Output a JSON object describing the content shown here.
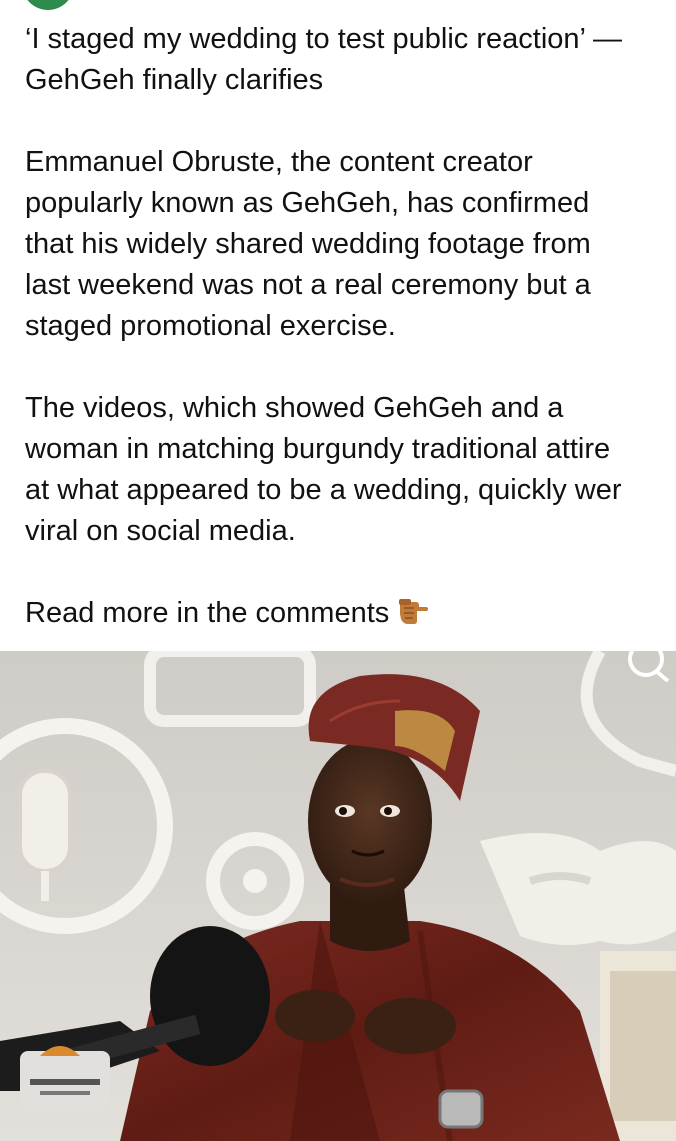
{
  "post": {
    "headline_line1": "‘I staged my wedding to test public reaction’ —",
    "headline_line2": "GehGeh finally clarifies",
    "para1": [
      "Emmanuel Obruste, the content creator",
      "popularly known as GehGeh, has confirmed",
      "that his widely shared wedding footage from",
      "last weekend was not a real ceremony but a",
      "staged promotional exercise."
    ],
    "para2": [
      "The videos, which showed GehGeh and a",
      "woman in matching burgundy traditional attire",
      "at what appeared to be a wedding, quickly wer",
      "viral on social media."
    ],
    "read_more": "Read more in the comments",
    "read_more_icon": "backhand-index-pointing-right-icon"
  },
  "photo": {
    "description_icon": "podcast-studio-photo",
    "colors": {
      "attire": "#6b2018",
      "cap": "#7a2a22",
      "skin": "#3d2418",
      "background": "#d9d6d1",
      "accent": "#d98a2c"
    }
  }
}
